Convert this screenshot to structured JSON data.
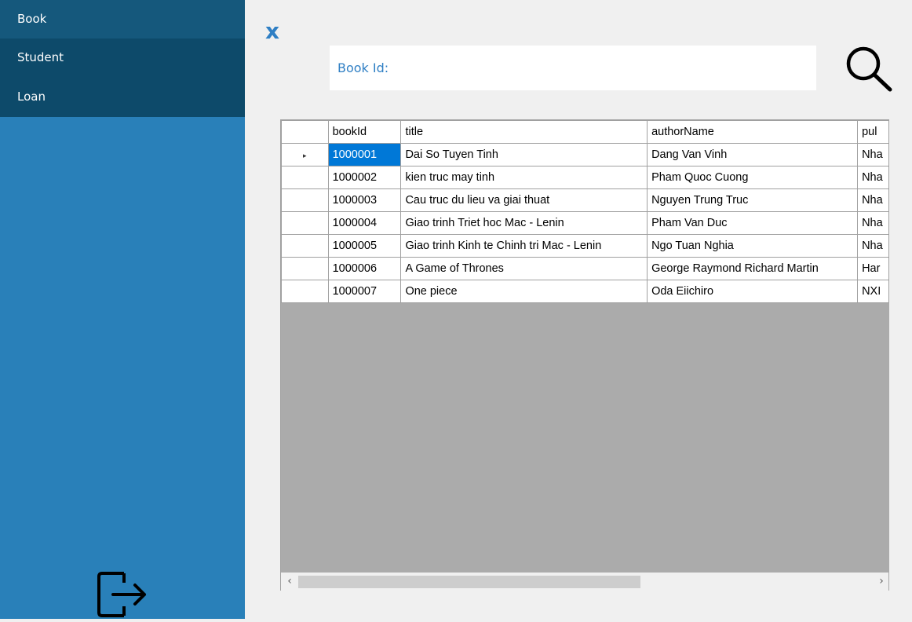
{
  "sidebar": {
    "items": [
      {
        "label": "Book"
      },
      {
        "label": "Student"
      },
      {
        "label": "Loan"
      }
    ],
    "logout_icon": "logout-icon"
  },
  "header": {
    "close_label": "x"
  },
  "search": {
    "label": "Book Id:",
    "value": "",
    "icon": "search-icon"
  },
  "grid": {
    "columns": [
      "bookId",
      "title",
      "authorName",
      "pul"
    ],
    "rows": [
      [
        "1000001",
        "Dai So Tuyen Tinh",
        "Dang Van Vinh",
        "Nha"
      ],
      [
        "1000002",
        "kien truc may tinh",
        "Pham Quoc Cuong",
        "Nha"
      ],
      [
        "1000003",
        "Cau truc du lieu va giai thuat",
        "Nguyen Trung Truc",
        "Nha"
      ],
      [
        "1000004",
        "Giao trinh Triet hoc Mac - Lenin",
        "Pham Van Duc",
        "Nha"
      ],
      [
        "1000005",
        "Giao trinh Kinh te Chinh tri Mac - Lenin",
        "Ngo Tuan Nghia",
        "Nha"
      ],
      [
        "1000006",
        "A Game of Thrones",
        "George Raymond Richard Martin",
        "Har"
      ],
      [
        "1000007",
        "One piece",
        "Oda Eiichiro",
        "NXI"
      ]
    ],
    "current_row_marker": "▸",
    "scroll_left": "‹",
    "scroll_right": "›"
  },
  "colors": {
    "sidebar": "#2980b9",
    "menu": "#0d4a6a",
    "accent": "#2f7fc4",
    "selection": "#0078d7",
    "grid_background": "#ababab"
  }
}
